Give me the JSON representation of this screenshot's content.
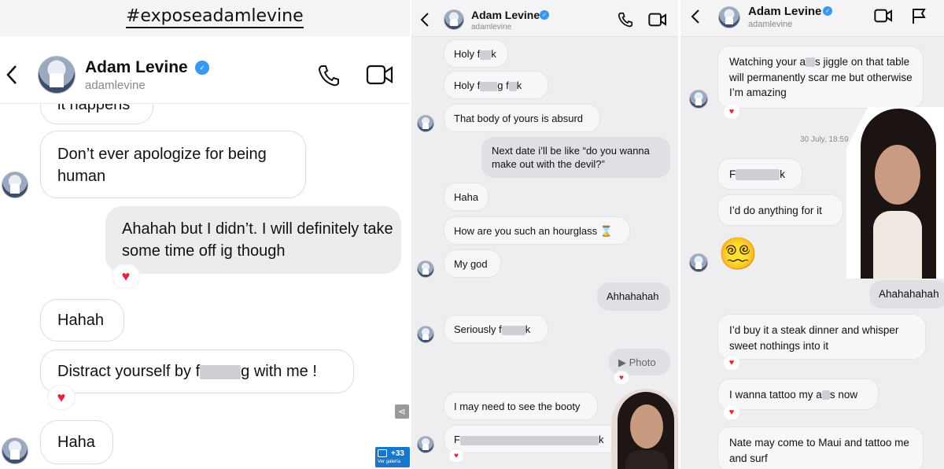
{
  "caption": "#exposeadamlevine",
  "header": {
    "name": "Adam Levine",
    "username": "adamlevine"
  },
  "panel1": {
    "messages": [
      {
        "dir": "in",
        "text": "it happens"
      },
      {
        "dir": "in",
        "text": "Don’t ever apologize for being human"
      },
      {
        "dir": "out",
        "text": "Ahahah but I didn’t. I will definitely take some time off ig though"
      },
      {
        "dir": "in",
        "text": "Hahah"
      },
      {
        "dir": "in",
        "text_before": "Distract yourself by f",
        "text_after": "g with me !"
      },
      {
        "dir": "in",
        "text": "Haha"
      }
    ],
    "gallery_badge": "+33",
    "gallery_caption": "Ver galería"
  },
  "panel2": {
    "messages": [
      {
        "dir": "in",
        "text_before": "Holy f",
        "text_after": "k"
      },
      {
        "dir": "in",
        "text_before": "Holy f",
        "text_mid": "g f",
        "text_after": "k"
      },
      {
        "dir": "in",
        "text": "That body of yours is absurd"
      },
      {
        "dir": "out",
        "text": "Next date i’ll be like “do you wanna make out with the devil?”"
      },
      {
        "dir": "in",
        "text": "Haha"
      },
      {
        "dir": "in",
        "text": "How are you such an hourglass ⌛"
      },
      {
        "dir": "in",
        "text": "My god"
      },
      {
        "dir": "out",
        "text": "Ahhahahah"
      },
      {
        "dir": "in",
        "text_before": "Seriously f",
        "text_after": "k"
      },
      {
        "dir": "out",
        "text": "▶ Photo"
      },
      {
        "dir": "in",
        "text": "I may need to see the booty"
      },
      {
        "dir": "in",
        "text_before": "F",
        "text_after": "k"
      }
    ]
  },
  "panel3": {
    "messages": [
      {
        "dir": "in",
        "text_before": "Watching your a",
        "text_after": "s jiggle on that table will permanently scar me but otherwise I’m amazing"
      },
      {
        "dir": "in",
        "text_before": "F",
        "text_after": "k"
      },
      {
        "dir": "in",
        "text": "I’d do anything for it"
      },
      {
        "dir": "in",
        "text": "😵‍💫"
      },
      {
        "dir": "out",
        "text": "Ahahahahah"
      },
      {
        "dir": "in",
        "text": "I’d buy it a steak dinner and whisper sweet nothings into it"
      },
      {
        "dir": "in",
        "text_before": "I wanna tattoo my a",
        "text_after": "s now"
      },
      {
        "dir": "in",
        "text": "Nate may come to Maui and tattoo me and surf"
      }
    ],
    "timestamp": "30 July, 18:59"
  },
  "colors": {
    "verified": "#3897f0",
    "heart": "#e0263b",
    "badge": "#1877c9"
  }
}
